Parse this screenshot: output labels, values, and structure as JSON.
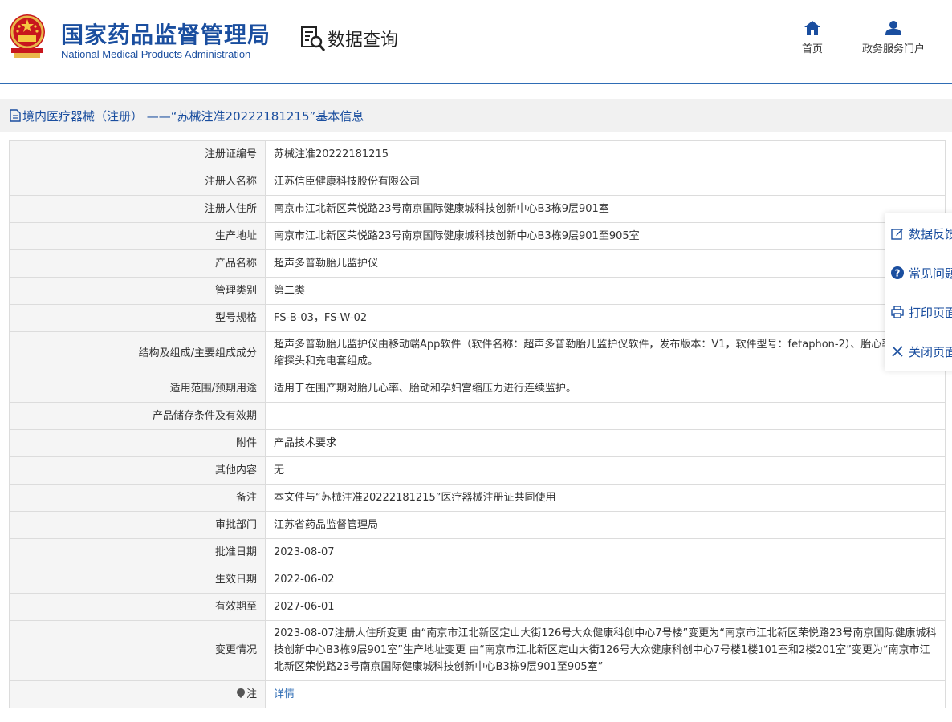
{
  "header": {
    "brand_cn": "国家药品监督管理局",
    "brand_en": "National Medical Products Administration",
    "query_label": "数据查询",
    "nav": {
      "home": "首页",
      "portal": "政务服务门户"
    }
  },
  "title": "境内医疗器械（注册） ——“苏械注准20222181215”基本信息",
  "rows": [
    {
      "label": "注册证编号",
      "value": "苏械注准20222181215"
    },
    {
      "label": "注册人名称",
      "value": "江苏信臣健康科技股份有限公司"
    },
    {
      "label": "注册人住所",
      "value": "南京市江北新区荣悦路23号南京国际健康城科技创新中心B3栋9层901室"
    },
    {
      "label": "生产地址",
      "value": "南京市江北新区荣悦路23号南京国际健康城科技创新中心B3栋9层901至905室"
    },
    {
      "label": "产品名称",
      "value": "超声多普勒胎儿监护仪"
    },
    {
      "label": "管理类别",
      "value": "第二类"
    },
    {
      "label": "型号规格",
      "value": "FS-B-03，FS-W-02"
    },
    {
      "label": "结构及组成/主要组成成分",
      "value": "超声多普勒胎儿监护仪由移动端App软件（软件名称：超声多普勒胎儿监护仪软件，发布版本：V1，软件型号：fetaphon-2）、胎心率探头、宫缩探头和充电套组成。"
    },
    {
      "label": "适用范围/预期用途",
      "value": "适用于在围产期对胎儿心率、胎动和孕妇宫缩压力进行连续监护。"
    },
    {
      "label": "产品储存条件及有效期",
      "value": ""
    },
    {
      "label": "附件",
      "value": "产品技术要求"
    },
    {
      "label": "其他内容",
      "value": "无"
    },
    {
      "label": "备注",
      "value": "本文件与“苏械注准20222181215”医疗器械注册证共同使用"
    },
    {
      "label": "审批部门",
      "value": "江苏省药品监督管理局"
    },
    {
      "label": "批准日期",
      "value": "2023-08-07"
    },
    {
      "label": "生效日期",
      "value": "2022-06-02"
    },
    {
      "label": "有效期至",
      "value": "2027-06-01"
    },
    {
      "label": "变更情况",
      "value": "2023-08-07注册人住所变更 由“南京市江北新区定山大街126号大众健康科创中心7号楼”变更为“南京市江北新区荣悦路23号南京国际健康城科技创新中心B3栋9层901室”生产地址变更 由“南京市江北新区定山大街126号大众健康科创中心7号楼1楼101室和2楼201室”变更为“南京市江北新区荣悦路23号南京国际健康城科技创新中心B3栋9层901至905室”"
    }
  ],
  "note_row": {
    "label": "注",
    "link": "详情"
  },
  "side_panel": {
    "feedback": "数据反馈",
    "faq": "常见问题",
    "print": "打印页面",
    "close": "关闭页面"
  },
  "colors": {
    "brand": "#1a4e9f",
    "link": "#2f6db5",
    "label_bg": "#f5f5f5"
  }
}
